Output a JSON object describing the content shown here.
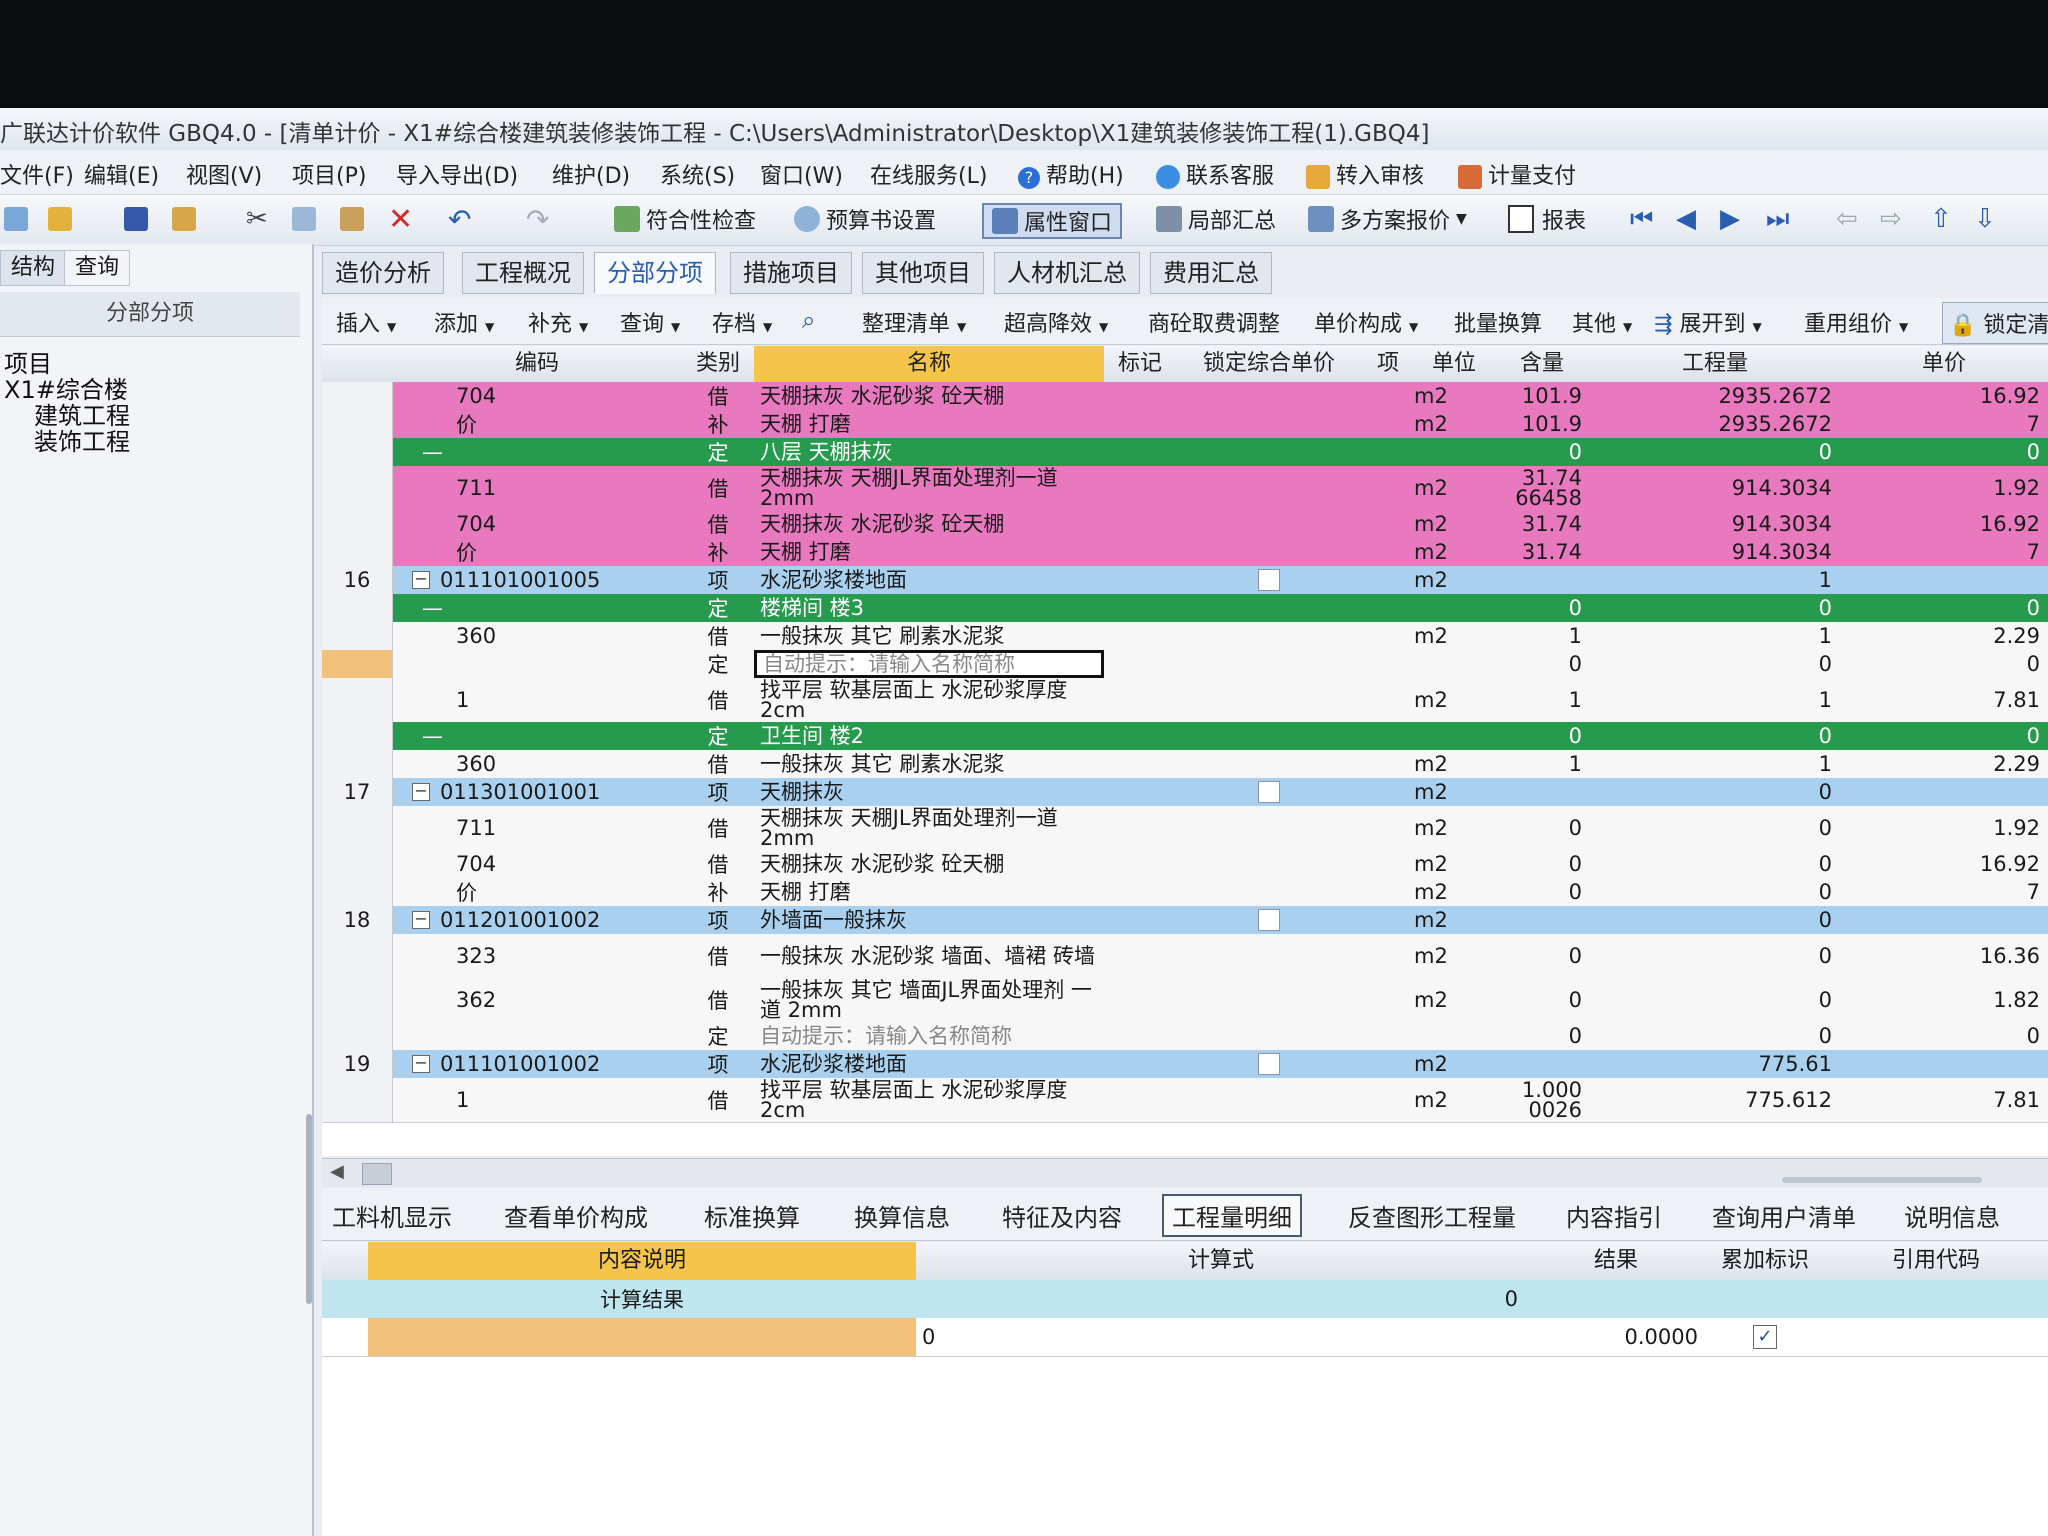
{
  "window": {
    "title": "广联达计价软件 GBQ4.0 - [清单计价 - X1#综合楼建筑装修装饰工程 - C:\\Users\\Administrator\\Desktop\\X1建筑装修装饰工程(1).GBQ4]"
  },
  "menu": [
    "文件(F)",
    "编辑(E)",
    "视图(V)",
    "项目(P)",
    "导入导出(D)",
    "维护(D)",
    "系统(S)",
    "窗口(W)",
    "在线服务(L)",
    "帮助(H)",
    "联系客服",
    "转入审核",
    "计量支付"
  ],
  "toolbar": {
    "check": "符合性检查",
    "budget": "预算书设置",
    "props": "属性窗口",
    "partial": "局部汇总",
    "multi": "多方案报价",
    "report": "报表"
  },
  "left_panel": {
    "tab_structure": "结构",
    "tab_query": "查询",
    "header": "分部分项",
    "tree": [
      "项目",
      "X1#综合楼",
      "建筑工程",
      "装饰工程"
    ]
  },
  "main_tabs": [
    "造价分析",
    "工程概况",
    "分部分项",
    "措施项目",
    "其他项目",
    "人材机汇总",
    "费用汇总"
  ],
  "sub_toolbar": [
    "插入",
    "添加",
    "补充",
    "查询",
    "存档",
    "整理清单",
    "超高降效",
    "商砼取费调整",
    "单价构成",
    "批量换算",
    "其他",
    "展开到",
    "重用组价",
    "锁定清"
  ],
  "grid": {
    "headers": {
      "code": "编码",
      "type": "类别",
      "name": "名称",
      "mark": "标记",
      "lock": "锁定综合单价",
      "item": "项",
      "unit": "单位",
      "content": "含量",
      "qty": "工程量",
      "price": "单价"
    },
    "rows": [
      {
        "style": "pink",
        "num": "",
        "code": "704",
        "type": "借",
        "name": "天棚抹灰 水泥砂浆 砼天棚",
        "unit": "m2",
        "content": "101.9",
        "qty": "2935.2672",
        "price": "16.92"
      },
      {
        "style": "pink",
        "num": "",
        "code": "价",
        "type": "补",
        "name": "天棚 打磨",
        "unit": "m2",
        "content": "101.9",
        "qty": "2935.2672",
        "price": "7"
      },
      {
        "style": "green",
        "num": "",
        "code": "—",
        "type": "定",
        "name": "八层 天棚抹灰",
        "unit": "",
        "content": "0",
        "qty": "0",
        "price": "0"
      },
      {
        "style": "pink",
        "num": "",
        "code": "711",
        "type": "借",
        "name": "天棚抹灰 天棚JL界面处理剂一道 2mm",
        "unit": "m2",
        "content": "31.74 66458",
        "qty": "914.3034",
        "price": "1.92"
      },
      {
        "style": "pink",
        "num": "",
        "code": "704",
        "type": "借",
        "name": "天棚抹灰 水泥砂浆 砼天棚",
        "unit": "m2",
        "content": "31.74",
        "qty": "914.3034",
        "price": "16.92"
      },
      {
        "style": "pink",
        "num": "",
        "code": "价",
        "type": "补",
        "name": "天棚 打磨",
        "unit": "m2",
        "content": "31.74",
        "qty": "914.3034",
        "price": "7"
      },
      {
        "style": "blue",
        "num": "16",
        "code": "011101001005",
        "type": "项",
        "name": "水泥砂浆楼地面",
        "unit": "m2",
        "content": "",
        "qty": "1",
        "price": ""
      },
      {
        "style": "green",
        "num": "",
        "code": "—",
        "type": "定",
        "name": "楼梯间 楼3",
        "unit": "",
        "content": "0",
        "qty": "0",
        "price": "0"
      },
      {
        "style": "white",
        "num": "",
        "code": "360",
        "type": "借",
        "name": "一般抹灰 其它 刷素水泥浆",
        "unit": "m2",
        "content": "1",
        "qty": "1",
        "price": "2.29"
      },
      {
        "style": "white",
        "num": "",
        "code": "",
        "type": "定",
        "name": "自动提示：请输入名称简称",
        "unit": "",
        "content": "0",
        "qty": "0",
        "price": "0"
      },
      {
        "style": "white",
        "num": "",
        "code": "1",
        "type": "借",
        "name": "找平层 软基层面上 水泥砂浆厚度 2cm",
        "unit": "m2",
        "content": "1",
        "qty": "1",
        "price": "7.81"
      },
      {
        "style": "green",
        "num": "",
        "code": "—",
        "type": "定",
        "name": "卫生间 楼2",
        "unit": "",
        "content": "0",
        "qty": "0",
        "price": "0"
      },
      {
        "style": "white",
        "num": "",
        "code": "360",
        "type": "借",
        "name": "一般抹灰 其它 刷素水泥浆",
        "unit": "m2",
        "content": "1",
        "qty": "1",
        "price": "2.29"
      },
      {
        "style": "blue",
        "num": "17",
        "code": "011301001001",
        "type": "项",
        "name": "天棚抹灰",
        "unit": "m2",
        "content": "",
        "qty": "0",
        "price": ""
      },
      {
        "style": "white",
        "num": "",
        "code": "711",
        "type": "借",
        "name": "天棚抹灰 天棚JL界面处理剂一道 2mm",
        "unit": "m2",
        "content": "0",
        "qty": "0",
        "price": "1.92"
      },
      {
        "style": "white",
        "num": "",
        "code": "704",
        "type": "借",
        "name": "天棚抹灰 水泥砂浆 砼天棚",
        "unit": "m2",
        "content": "0",
        "qty": "0",
        "price": "16.92"
      },
      {
        "style": "white",
        "num": "",
        "code": "价",
        "type": "补",
        "name": "天棚 打磨",
        "unit": "m2",
        "content": "0",
        "qty": "0",
        "price": "7"
      },
      {
        "style": "blue",
        "num": "18",
        "code": "011201001002",
        "type": "项",
        "name": "外墙面一般抹灰",
        "unit": "m2",
        "content": "",
        "qty": "0",
        "price": ""
      },
      {
        "style": "white",
        "num": "",
        "code": "323",
        "type": "借",
        "name": "一般抹灰 水泥砂浆 墙面、墙裙 砖墙",
        "unit": "m2",
        "content": "0",
        "qty": "0",
        "price": "16.36"
      },
      {
        "style": "white",
        "num": "",
        "code": "362",
        "type": "借",
        "name": "一般抹灰 其它 墙面JL界面处理剂 一道 2mm",
        "unit": "m2",
        "content": "0",
        "qty": "0",
        "price": "1.82"
      },
      {
        "style": "white",
        "num": "",
        "code": "",
        "type": "定",
        "name": "自动提示：请输入名称简称",
        "unit": "",
        "content": "0",
        "qty": "0",
        "price": "0"
      },
      {
        "style": "blue",
        "num": "19",
        "code": "011101001002",
        "type": "项",
        "name": "水泥砂浆楼地面",
        "unit": "m2",
        "content": "",
        "qty": "775.61",
        "price": ""
      },
      {
        "style": "white",
        "num": "",
        "code": "1",
        "type": "借",
        "name": "找平层 软基层面上 水泥砂浆厚度 2cm",
        "unit": "m2",
        "content": "1.000 0026",
        "qty": "775.612",
        "price": "7.81"
      }
    ]
  },
  "bottom_tabs": [
    "工料机显示",
    "查看单价构成",
    "标准换算",
    "换算信息",
    "特征及内容",
    "工程量明细",
    "反查图形工程量",
    "内容指引",
    "查询用户清单",
    "说明信息"
  ],
  "detail": {
    "headers": {
      "desc": "内容说明",
      "formula": "计算式",
      "result": "结果",
      "acc": "累加标识",
      "ref": "引用代码"
    },
    "rows": [
      {
        "desc": "计算结果",
        "formula": "",
        "result": "0"
      },
      {
        "desc": "",
        "formula": "0",
        "result": "0.0000"
      }
    ]
  }
}
